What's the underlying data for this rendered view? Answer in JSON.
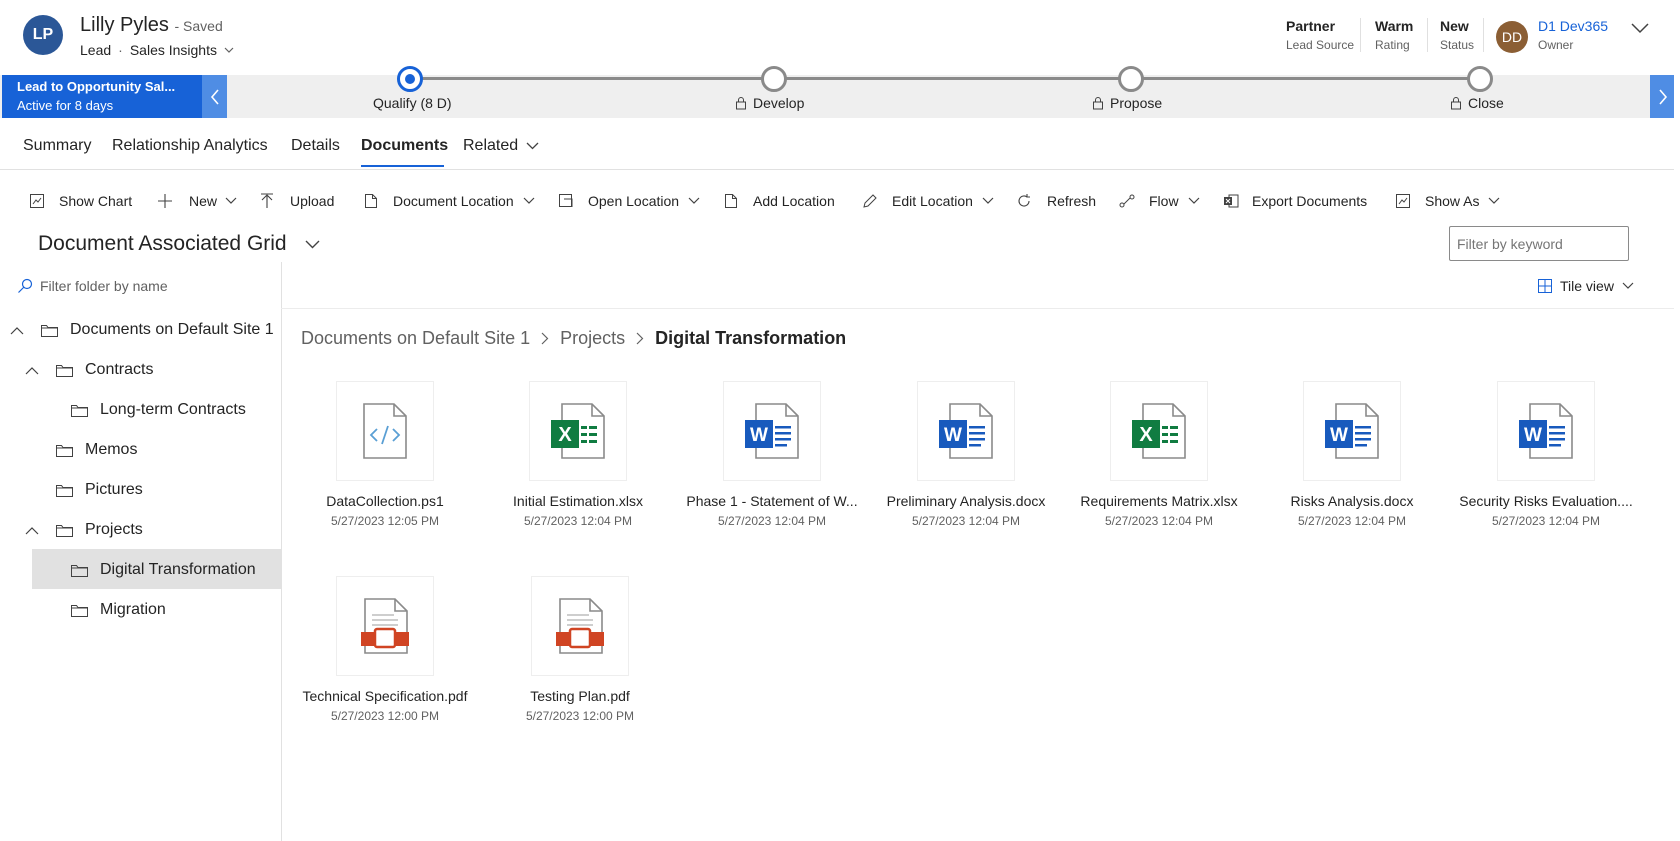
{
  "header": {
    "avatar_initials": "LP",
    "name": "Lilly Pyles",
    "saved": "- Saved",
    "entity": "Lead",
    "form": "Sales Insights",
    "fields": [
      {
        "value": "Partner",
        "label": "Lead Source"
      },
      {
        "value": "Warm",
        "label": "Rating"
      },
      {
        "value": "New",
        "label": "Status"
      }
    ],
    "owner": {
      "initials": "DD",
      "name": "D1 Dev365",
      "label": "Owner"
    }
  },
  "bpf": {
    "title": "Lead to Opportunity Sal...",
    "subtitle": "Active for 8 days",
    "stages": [
      {
        "label": "Qualify  (8 D)",
        "active": true,
        "locked": false
      },
      {
        "label": "Develop",
        "active": false,
        "locked": true
      },
      {
        "label": "Propose",
        "active": false,
        "locked": true
      },
      {
        "label": "Close",
        "active": false,
        "locked": true
      }
    ]
  },
  "tabs": [
    "Summary",
    "Relationship Analytics",
    "Details",
    "Documents",
    "Related"
  ],
  "selected_tab": "Documents",
  "commands": {
    "show_chart": "Show Chart",
    "new": "New",
    "upload": "Upload",
    "document_location": "Document Location",
    "open_location": "Open Location",
    "add_location": "Add Location",
    "edit_location": "Edit Location",
    "refresh": "Refresh",
    "flow": "Flow",
    "export_documents": "Export Documents",
    "show_as": "Show As"
  },
  "grid": {
    "title": "Document Associated Grid",
    "filter_placeholder": "Filter by keyword",
    "folder_filter_placeholder": "Filter folder by name",
    "view": "Tile view"
  },
  "tree": {
    "root": "Documents on Default Site 1",
    "contracts": "Contracts",
    "long_term": "Long-term Contracts",
    "memos": "Memos",
    "pictures": "Pictures",
    "projects": "Projects",
    "digital": "Digital Transformation",
    "migration": "Migration"
  },
  "breadcrumb": [
    "Documents on Default Site 1",
    "Projects",
    "Digital Transformation"
  ],
  "files": [
    {
      "name": "DataCollection.ps1",
      "date": "5/27/2023 12:05 PM",
      "type": "code"
    },
    {
      "name": "Initial Estimation.xlsx",
      "date": "5/27/2023 12:04 PM",
      "type": "excel"
    },
    {
      "name": "Phase 1 - Statement of W...",
      "date": "5/27/2023 12:04 PM",
      "type": "word"
    },
    {
      "name": "Preliminary Analysis.docx",
      "date": "5/27/2023 12:04 PM",
      "type": "word"
    },
    {
      "name": "Requirements Matrix.xlsx",
      "date": "5/27/2023 12:04 PM",
      "type": "excel"
    },
    {
      "name": "Risks Analysis.docx",
      "date": "5/27/2023 12:04 PM",
      "type": "word"
    },
    {
      "name": "Security Risks Evaluation....",
      "date": "5/27/2023 12:04 PM",
      "type": "word"
    },
    {
      "name": "Technical Specification.pdf",
      "date": "5/27/2023 12:00 PM",
      "type": "pdf"
    },
    {
      "name": "Testing Plan.pdf",
      "date": "5/27/2023 12:00 PM",
      "type": "pdf"
    }
  ],
  "colors": {
    "accent": "#1762d7",
    "avatar_lead": "#2b5797",
    "avatar_owner": "#8b5e34",
    "excel": "#107c41",
    "word": "#185abd",
    "pdf": "#d04423"
  }
}
